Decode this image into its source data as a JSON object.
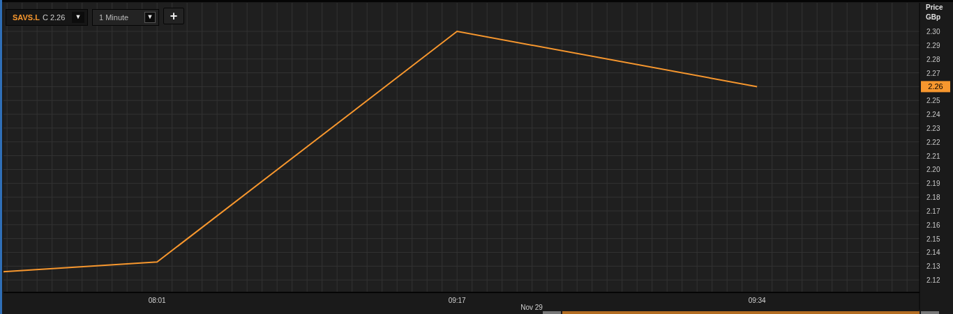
{
  "toolbar": {
    "close_prefix": "C",
    "close_value": "2.26",
    "symbol_dropdown": "▼",
    "interval": "1 Minute",
    "interval_dropdown": "▼",
    "add_button": "+"
  },
  "price_axis": {
    "title": "Price",
    "unit": "GBp",
    "last_price": "2.26"
  },
  "date_label": "Nov 29",
  "chart_data": {
    "type": "line",
    "categories": [
      null,
      "08:01",
      "09:17",
      "09:34"
    ],
    "series": [
      {
        "name": "SAVS.L",
        "color": "#f7972e",
        "values": [
          2.1193,
          2.133,
          2.3,
          2.26
        ]
      }
    ],
    "grid": true,
    "ylim": [
      2.111,
      2.3207
    ],
    "yticks": [
      2.12,
      2.13,
      2.14,
      2.15,
      2.16,
      2.17,
      2.18,
      2.19,
      {
        "value": 2.2,
        "label": "2.20"
      },
      2.21,
      2.22,
      2.23,
      2.24,
      2.25,
      2.26,
      2.27,
      2.28,
      2.29,
      {
        "value": 2.3,
        "label": "2.30"
      }
    ]
  }
}
